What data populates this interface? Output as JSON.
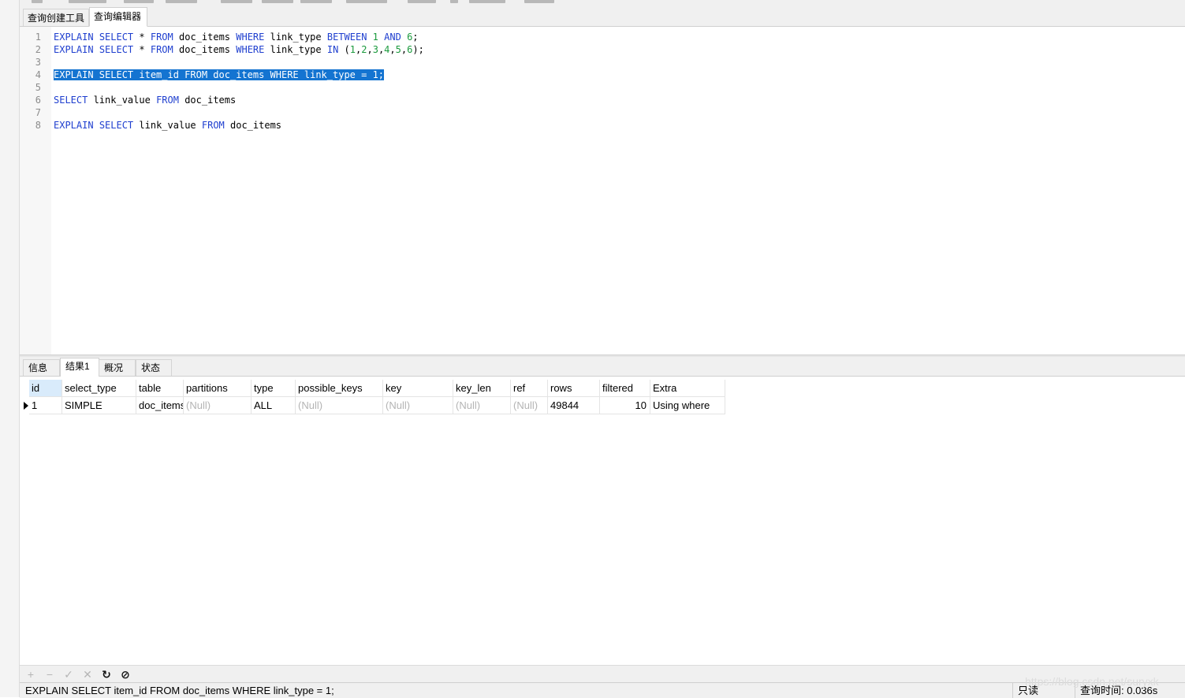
{
  "editor_tabs": [
    {
      "label": "查询创建工具",
      "active": false
    },
    {
      "label": "查询编辑器",
      "active": true
    }
  ],
  "editor": {
    "lines": [
      {
        "n": "1",
        "tokens": [
          [
            "kw",
            "EXPLAIN"
          ],
          [
            "t",
            " "
          ],
          [
            "kw",
            "SELECT"
          ],
          [
            "t",
            " * "
          ],
          [
            "kw",
            "FROM"
          ],
          [
            "t",
            " doc_items "
          ],
          [
            "kw",
            "WHERE"
          ],
          [
            "t",
            " link_type "
          ],
          [
            "kw",
            "BETWEEN"
          ],
          [
            "t",
            " "
          ],
          [
            "num",
            "1"
          ],
          [
            "t",
            " "
          ],
          [
            "kw",
            "AND"
          ],
          [
            "t",
            " "
          ],
          [
            "num",
            "6"
          ],
          [
            "t",
            ";"
          ]
        ]
      },
      {
        "n": "2",
        "tokens": [
          [
            "kw",
            "EXPLAIN"
          ],
          [
            "t",
            " "
          ],
          [
            "kw",
            "SELECT"
          ],
          [
            "t",
            " * "
          ],
          [
            "kw",
            "FROM"
          ],
          [
            "t",
            " doc_items "
          ],
          [
            "kw",
            "WHERE"
          ],
          [
            "t",
            " link_type "
          ],
          [
            "kw",
            "IN"
          ],
          [
            "t",
            " ("
          ],
          [
            "num",
            "1"
          ],
          [
            "t",
            ","
          ],
          [
            "num",
            "2"
          ],
          [
            "t",
            ","
          ],
          [
            "num",
            "3"
          ],
          [
            "t",
            ","
          ],
          [
            "num",
            "4"
          ],
          [
            "t",
            ","
          ],
          [
            "num",
            "5"
          ],
          [
            "t",
            ","
          ],
          [
            "num",
            "6"
          ],
          [
            "t",
            ");"
          ]
        ]
      },
      {
        "n": "3",
        "tokens": []
      },
      {
        "n": "4",
        "selected": true,
        "tokens": [
          [
            "sel",
            "EXPLAIN SELECT item_id FROM doc_items WHERE link_type = 1;"
          ]
        ]
      },
      {
        "n": "5",
        "tokens": []
      },
      {
        "n": "6",
        "tokens": [
          [
            "kw",
            "SELECT"
          ],
          [
            "t",
            " link_value "
          ],
          [
            "kw",
            "FROM"
          ],
          [
            "t",
            " doc_items"
          ]
        ]
      },
      {
        "n": "7",
        "tokens": []
      },
      {
        "n": "8",
        "tokens": [
          [
            "kw",
            "EXPLAIN"
          ],
          [
            "t",
            " "
          ],
          [
            "kw",
            "SELECT"
          ],
          [
            "t",
            " link_value "
          ],
          [
            "kw",
            "FROM"
          ],
          [
            "t",
            " doc_items"
          ]
        ]
      }
    ]
  },
  "result_tabs": [
    {
      "label": "信息",
      "active": false
    },
    {
      "label": "结果1",
      "active": true
    },
    {
      "label": "概况",
      "active": false
    },
    {
      "label": "状态",
      "active": false
    }
  ],
  "results": {
    "columns": [
      "id",
      "select_type",
      "table",
      "partitions",
      "type",
      "possible_keys",
      "key",
      "key_len",
      "ref",
      "rows",
      "filtered",
      "Extra"
    ],
    "rows": [
      [
        "1",
        "SIMPLE",
        "doc_items",
        "(Null)",
        "ALL",
        "(Null)",
        "(Null)",
        "(Null)",
        "(Null)",
        "49844",
        "10",
        "Using where"
      ]
    ]
  },
  "bottom_toolbar": [
    {
      "icon": "add-record-icon",
      "glyph": "+",
      "enabled": false
    },
    {
      "icon": "delete-record-icon",
      "glyph": "−",
      "enabled": false
    },
    {
      "icon": "apply-changes-icon",
      "glyph": "✓",
      "enabled": false
    },
    {
      "icon": "discard-changes-icon",
      "glyph": "✕",
      "enabled": false
    },
    {
      "icon": "refresh-icon",
      "glyph": "↻",
      "enabled": true
    },
    {
      "icon": "stop-icon",
      "glyph": "⊘",
      "enabled": true
    }
  ],
  "status": {
    "sql": "EXPLAIN SELECT item_id FROM doc_items WHERE link_type = 1;",
    "readonly": "只读",
    "query_time": "查询时间: 0.036s"
  },
  "watermark": "https://blog.csdn.net/suryxk"
}
